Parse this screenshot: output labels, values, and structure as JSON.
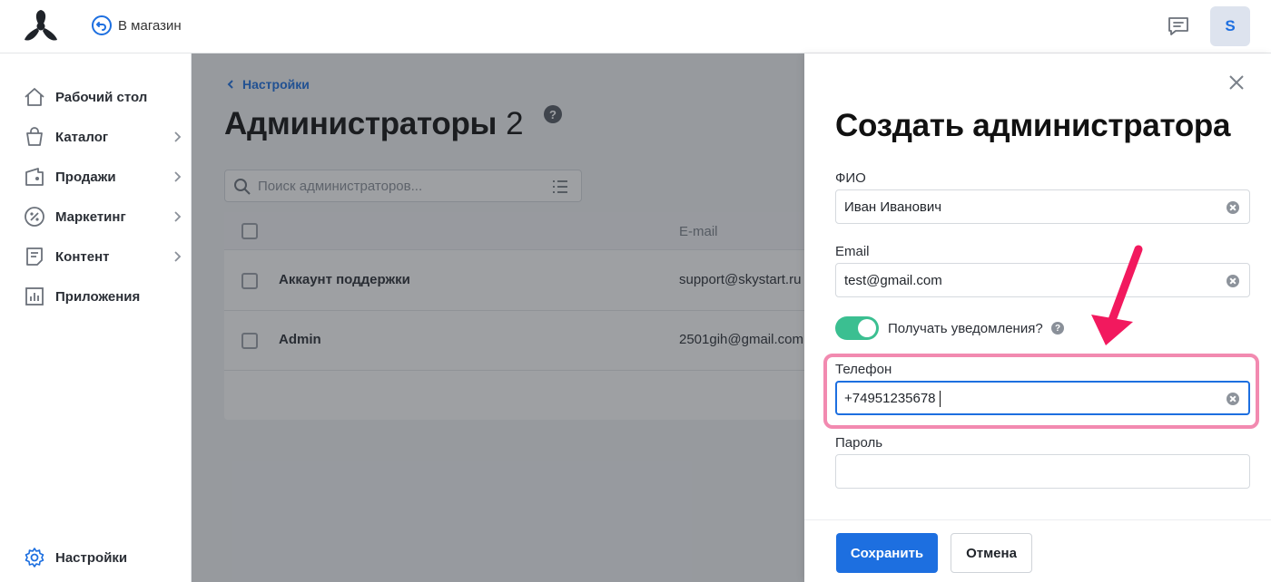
{
  "header": {
    "back_to_store": "В магазин",
    "avatar_letter": "S"
  },
  "sidebar": {
    "items": [
      {
        "label": "Рабочий стол",
        "icon": "home-icon",
        "has_arrow": false
      },
      {
        "label": "Каталог",
        "icon": "bag-icon",
        "has_arrow": true
      },
      {
        "label": "Продажи",
        "icon": "sales-icon",
        "has_arrow": true
      },
      {
        "label": "Маркетинг",
        "icon": "percent-icon",
        "has_arrow": true
      },
      {
        "label": "Контент",
        "icon": "document-icon",
        "has_arrow": true
      },
      {
        "label": "Приложения",
        "icon": "chart-icon",
        "has_arrow": false
      }
    ],
    "settings_label": "Настройки"
  },
  "main": {
    "breadcrumb": "Настройки",
    "title": "Администраторы",
    "count": "2",
    "search_placeholder": "Поиск администраторов...",
    "table": {
      "header_email": "E-mail",
      "rows": [
        {
          "name": "Аккаунт поддержки",
          "email": "support@skystart.ru"
        },
        {
          "name": "Admin",
          "email": "2501gih@gmail.com"
        }
      ]
    }
  },
  "panel": {
    "title": "Создать администратора",
    "fields": {
      "name_label": "ФИО",
      "name_value": "Иван Иванович",
      "email_label": "Email",
      "email_value": "test@gmail.com",
      "notify_label": "Получать уведомления?",
      "notify_on": true,
      "phone_label": "Телефон",
      "phone_value": "+74951235678",
      "password_label": "Пароль",
      "password_value": ""
    },
    "save_label": "Сохранить",
    "cancel_label": "Отмена"
  },
  "colors": {
    "accent": "#1d6fe0",
    "toggle_on": "#3bbf91",
    "highlight": "#f28ab0",
    "arrow": "#f2195e"
  }
}
